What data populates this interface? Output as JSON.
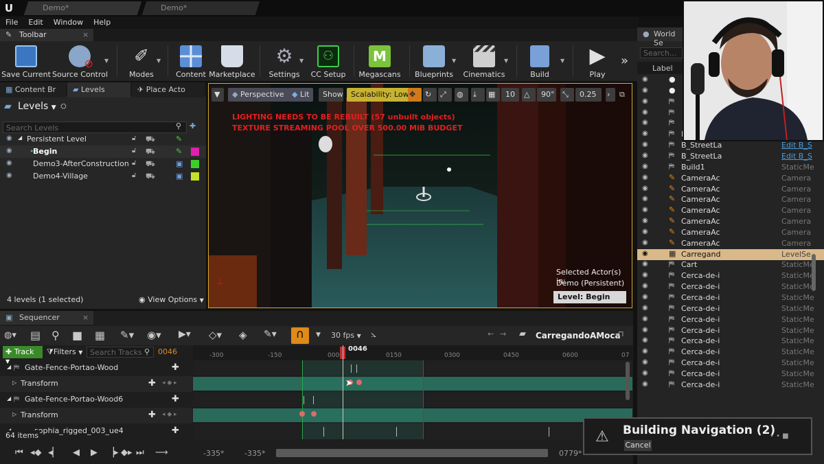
{
  "tabs": [
    {
      "label": "Demo*"
    },
    {
      "label": "Demo*"
    }
  ],
  "menu": [
    "File",
    "Edit",
    "Window",
    "Help"
  ],
  "toolbar": {
    "title": "Toolbar",
    "buttons": [
      {
        "label": "Save Current",
        "color": "#4a8fd8"
      },
      {
        "label": "Source Control",
        "color": "#7aa6d6"
      },
      {
        "label": "Modes",
        "color": "#d0d0d0"
      },
      {
        "label": "Content",
        "color": "#6a9ad8"
      },
      {
        "label": "Marketplace",
        "color": "#c0c8d8"
      },
      {
        "label": "Settings",
        "color": "#9aa3ad"
      },
      {
        "label": "CC Setup",
        "color": "#1a7a2a"
      },
      {
        "label": "Megascans",
        "color": "#78c232"
      },
      {
        "label": "Blueprints",
        "color": "#8ab0d8"
      },
      {
        "label": "Cinematics",
        "color": "#c8c8c8"
      },
      {
        "label": "Build",
        "color": "#7aa0d8"
      },
      {
        "label": "Play",
        "color": "#d8d8d8"
      }
    ],
    "more": "»"
  },
  "left_tabs": [
    "Content Br",
    "Levels",
    "Place Acto"
  ],
  "levels": {
    "title": "Levels",
    "search_placeholder": "Search Levels",
    "rows": [
      {
        "name": "Persistent Level",
        "color": "#7a7a7a"
      },
      {
        "name": "Begin",
        "color": "#e020b0"
      },
      {
        "name": "Demo3-AfterConstruction",
        "color": "#3ccf2a"
      },
      {
        "name": "Demo4-Village",
        "color": "#c6e02a"
      }
    ],
    "count": "4 levels (1 selected)",
    "view_options": "View Options"
  },
  "viewport": {
    "perspective": "Perspective",
    "lit": "Lit",
    "show": "Show",
    "scalability": "Scalability: Low",
    "grid": "10",
    "angle": "90°",
    "scale": "0.25",
    "warning1": "LIGHTING NEEDS TO BE REBUILT (57 unbuilt objects)",
    "warning2": "TEXTURE STREAMING POOL OVER 500.00 MiB BUDGET",
    "selected_in": "Selected Actor(s) in:",
    "selected_level": "Demo (Persistent)",
    "level_label": "Level:  Begin"
  },
  "sequencer": {
    "title": "Sequencer",
    "fps": "30 fps",
    "sequence_name": "CarregandoAMoca",
    "track_btn": "Track",
    "filters_btn": "Filters",
    "search_placeholder": "Search Tracks",
    "current_frame": "0046",
    "playhead_label": "0046",
    "ruler": [
      "-300",
      "-150",
      "0000",
      "0150",
      "0300",
      "0450",
      "0600",
      "07"
    ],
    "tracks": [
      {
        "label": "Gate-Fence-Portao-Wood",
        "kind": "actor"
      },
      {
        "label": "Transform",
        "kind": "sub"
      },
      {
        "label": "Gate-Fence-Portao-Wood6",
        "kind": "actor"
      },
      {
        "label": "Transform",
        "kind": "sub"
      },
      {
        "label": "sophia_rigged_003_ue4",
        "kind": "actor"
      }
    ],
    "items_count": "64 items",
    "range_start": "-335*",
    "range_start2": "-335*",
    "range_end": "0779*"
  },
  "outliner": {
    "title": "World Se",
    "search_placeholder": "Search...",
    "col_label": "Label",
    "rows": [
      {
        "name": "",
        "type": "",
        "icon": "sphere"
      },
      {
        "name": "",
        "type": "",
        "icon": "sphere"
      },
      {
        "name": "",
        "type": "",
        "icon": "mesh"
      },
      {
        "name": "",
        "type": "",
        "icon": "mesh"
      },
      {
        "name": "",
        "type": "",
        "icon": "mesh"
      },
      {
        "name": "B_StreetLa",
        "type": "Edit B_S",
        "icon": "mesh"
      },
      {
        "name": "B_StreetLa",
        "type": "Edit B_S",
        "icon": "mesh"
      },
      {
        "name": "B_StreetLa",
        "type": "Edit B_S",
        "icon": "mesh"
      },
      {
        "name": "Build1",
        "type": "StaticMe",
        "icon": "mesh"
      },
      {
        "name": "CameraAc",
        "type": "Camera",
        "icon": "camera"
      },
      {
        "name": "CameraAc",
        "type": "Camera",
        "icon": "camera"
      },
      {
        "name": "CameraAc",
        "type": "Camera",
        "icon": "camera"
      },
      {
        "name": "CameraAc",
        "type": "Camera",
        "icon": "camera"
      },
      {
        "name": "CameraAc",
        "type": "Camera",
        "icon": "camera"
      },
      {
        "name": "CameraAc",
        "type": "Camera",
        "icon": "camera"
      },
      {
        "name": "CameraAc",
        "type": "Camera",
        "icon": "camera"
      },
      {
        "name": "Carregand",
        "type": "LevelSe",
        "icon": "seq"
      },
      {
        "name": "Cart",
        "type": "StaticMe",
        "icon": "mesh"
      },
      {
        "name": "Cerca-de-i",
        "type": "StaticMe",
        "icon": "mesh"
      },
      {
        "name": "Cerca-de-i",
        "type": "StaticMe",
        "icon": "mesh"
      },
      {
        "name": "Cerca-de-i",
        "type": "StaticMe",
        "icon": "mesh"
      },
      {
        "name": "Cerca-de-i",
        "type": "StaticMe",
        "icon": "mesh"
      },
      {
        "name": "Cerca-de-i",
        "type": "StaticMe",
        "icon": "mesh"
      },
      {
        "name": "Cerca-de-i",
        "type": "StaticMe",
        "icon": "mesh"
      },
      {
        "name": "Cerca-de-i",
        "type": "StaticMe",
        "icon": "mesh"
      },
      {
        "name": "Cerca-de-i",
        "type": "StaticMe",
        "icon": "mesh"
      },
      {
        "name": "Cerca-de-i",
        "type": "StaticMe",
        "icon": "mesh"
      },
      {
        "name": "Cerca-de-i",
        "type": "StaticMe",
        "icon": "mesh"
      },
      {
        "name": "Cerca-de-i",
        "type": "StaticMe",
        "icon": "mesh"
      }
    ]
  },
  "notification": {
    "text": "Building Navigation (2)",
    "cancel": "Cancel"
  }
}
